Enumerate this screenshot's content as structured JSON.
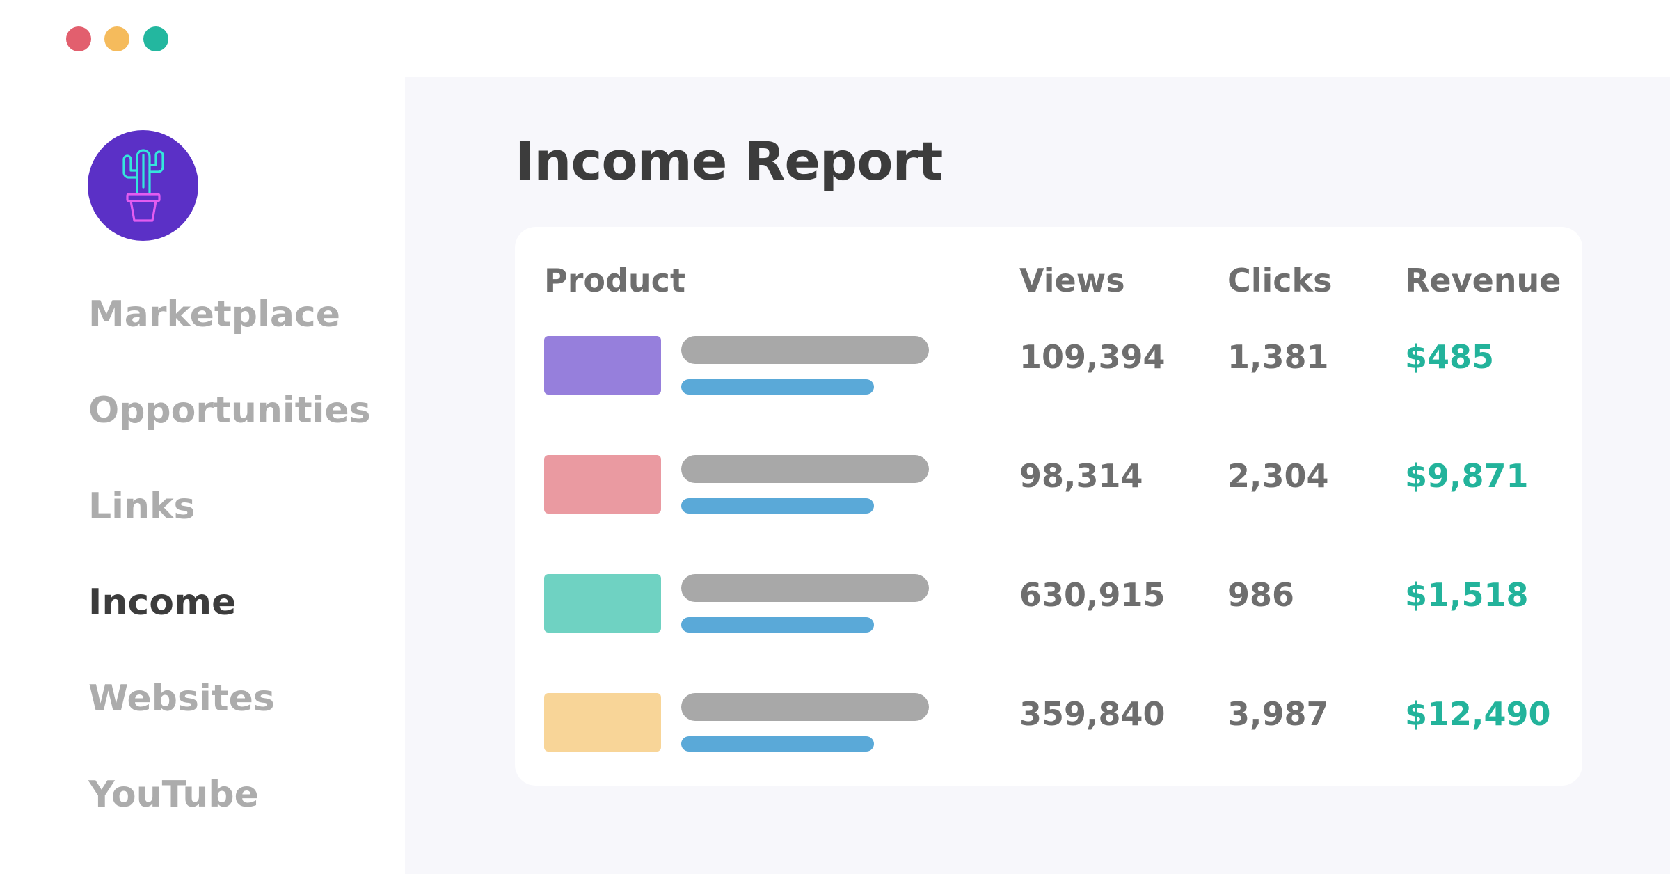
{
  "window": {
    "controls": [
      {
        "name": "close",
        "color": "#e25f6e"
      },
      {
        "name": "minimize",
        "color": "#f5bb5c"
      },
      {
        "name": "maximize",
        "color": "#23b79f"
      }
    ]
  },
  "sidebar": {
    "logo": {
      "icon": "cactus-icon",
      "background": "#5b30c6"
    },
    "items": [
      {
        "label": "Marketplace",
        "active": false
      },
      {
        "label": "Opportunities",
        "active": false
      },
      {
        "label": "Links",
        "active": false
      },
      {
        "label": "Income",
        "active": true
      },
      {
        "label": "Websites",
        "active": false
      },
      {
        "label": "YouTube",
        "active": false
      }
    ]
  },
  "main": {
    "title": "Income Report",
    "table": {
      "headers": {
        "product": "Product",
        "views": "Views",
        "clicks": "Clicks",
        "revenue": "Revenue"
      },
      "rows": [
        {
          "thumb_color": "#967fdc",
          "views": "109,394",
          "clicks": "1,381",
          "revenue": "$485"
        },
        {
          "thumb_color": "#ea9aa1",
          "views": "98,314",
          "clicks": "2,304",
          "revenue": "$9,871"
        },
        {
          "thumb_color": "#6fd2c2",
          "views": "630,915",
          "clicks": "986",
          "revenue": "$1,518"
        },
        {
          "thumb_color": "#f8d598",
          "views": "359,840",
          "clicks": "3,987",
          "revenue": "$12,490"
        }
      ]
    }
  },
  "colors": {
    "accent_revenue": "#23b39b",
    "placeholder_gray": "#a8a8a8",
    "placeholder_blue": "#5aa9d8"
  }
}
